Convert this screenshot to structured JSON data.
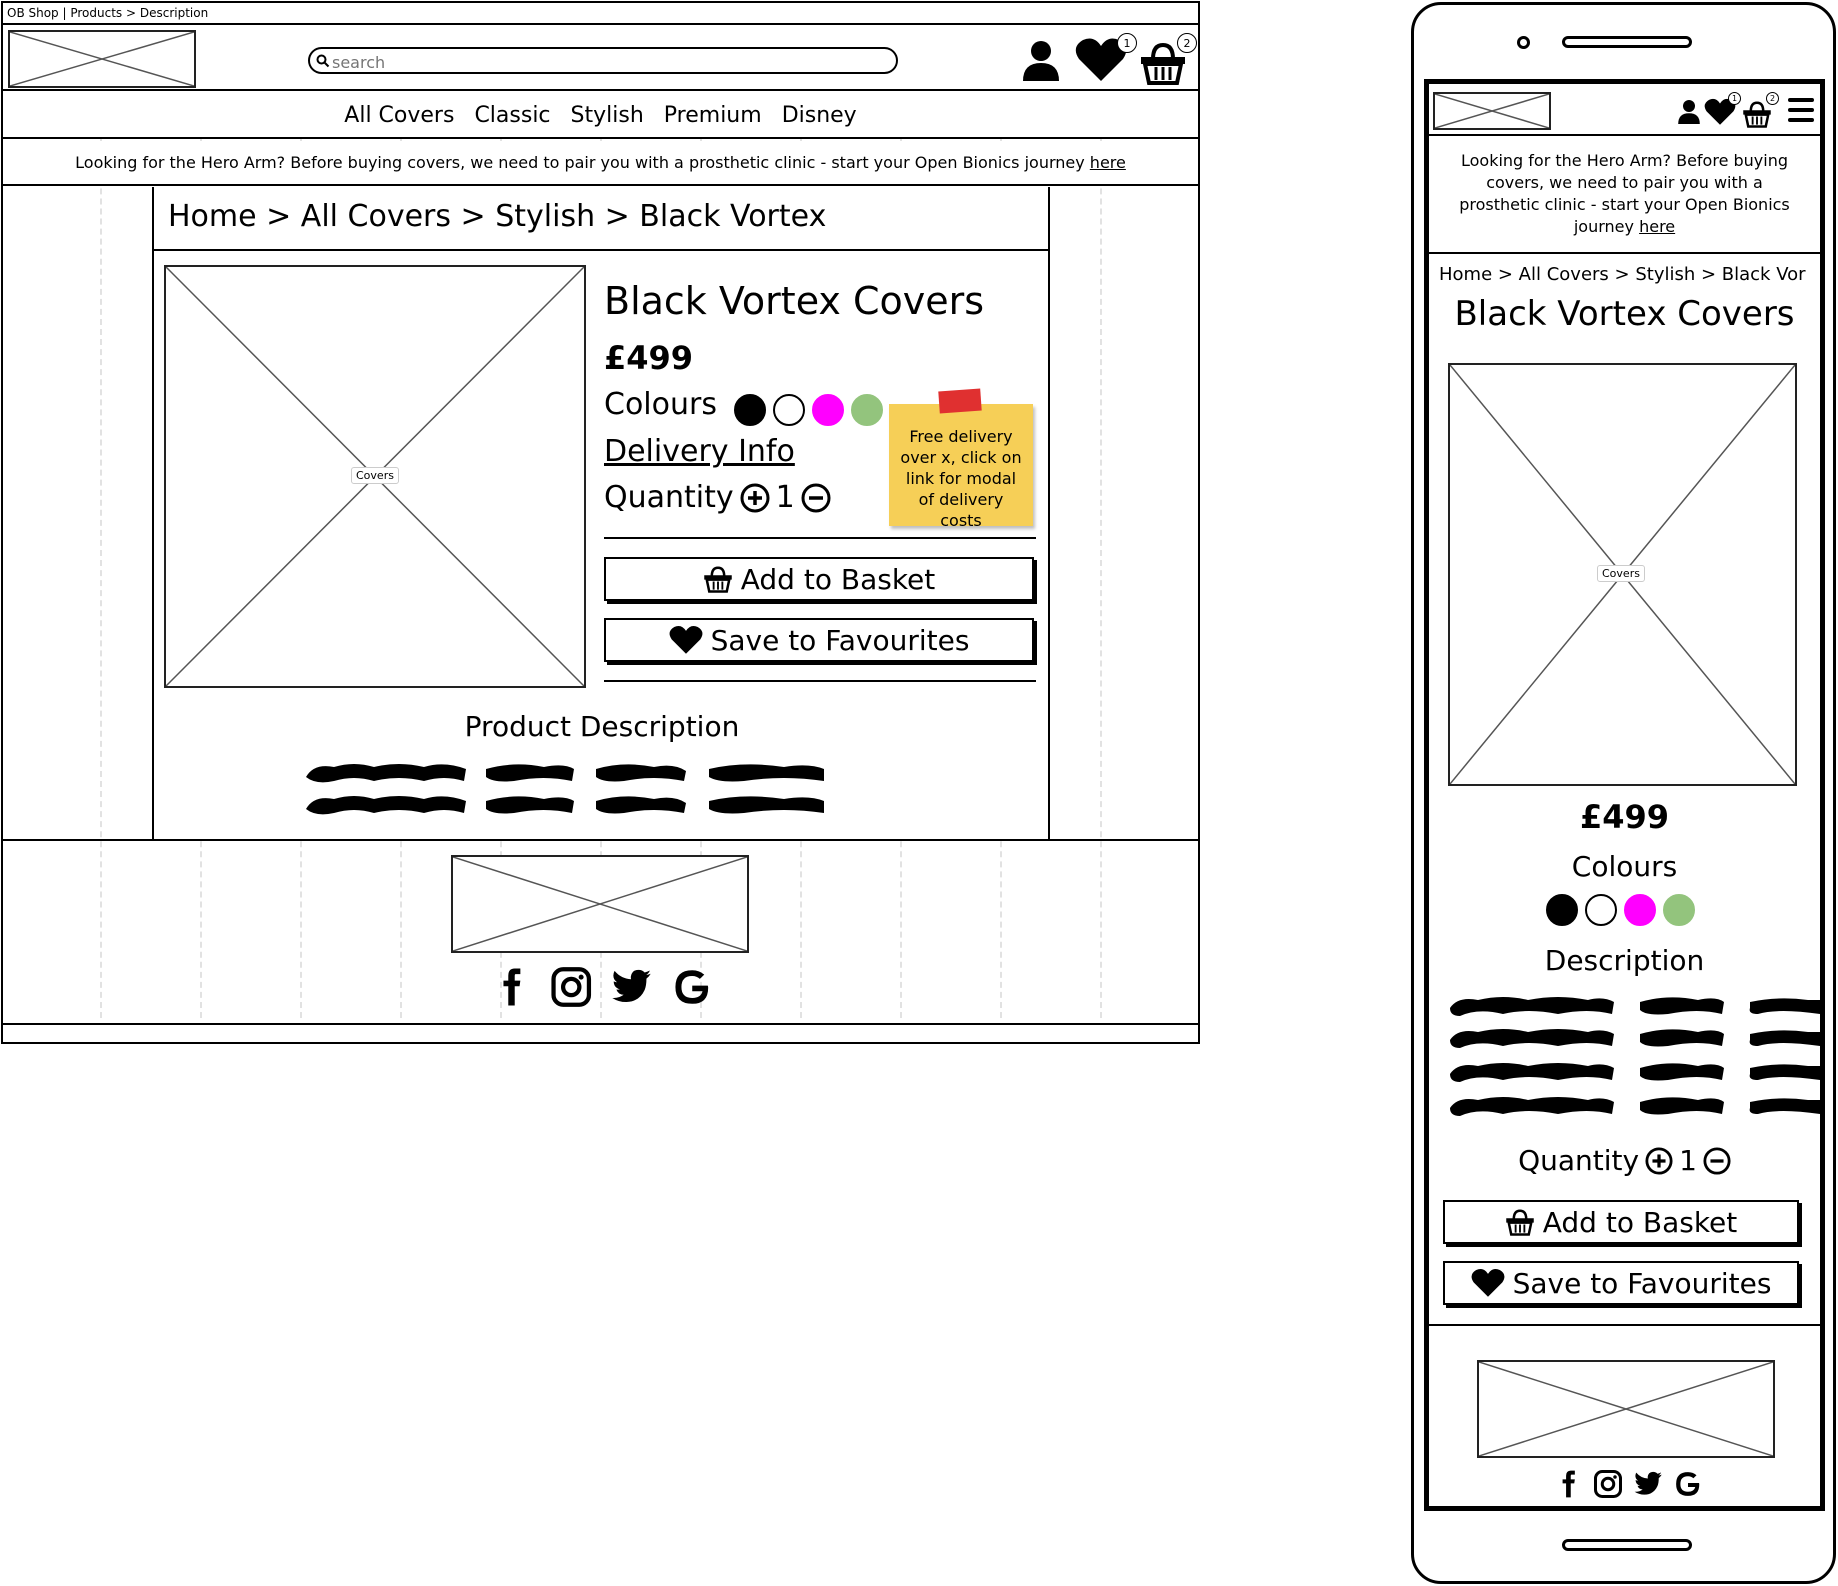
{
  "window": {
    "title": "OB Shop | Products > Description"
  },
  "desktop": {
    "search": {
      "placeholder": "search"
    },
    "header_badges": {
      "favourites": "1",
      "basket": "2"
    },
    "nav": [
      "All Covers",
      "Classic",
      "Stylish",
      "Premium",
      "Disney"
    ],
    "banner": {
      "text": "Looking for the Hero Arm? Before buying covers, we need to pair you with a prosthetic clinic - start your Open Bionics journey",
      "link": "here"
    },
    "breadcrumb": "Home > All Covers > Stylish > Black Vortex",
    "product": {
      "image_label": "Covers",
      "title": "Black Vortex Covers",
      "price": "£499",
      "colours_label": "Colours",
      "delivery_label": "Delivery Info",
      "quantity_label": "Quantity",
      "quantity_value": "1",
      "add_to_basket": "Add to Basket",
      "save_to_favourites": "Save to Favourites",
      "description_heading": "Product Description"
    },
    "sticky_note": "Free delivery over x, click on link for modal of delivery costs"
  },
  "mobile": {
    "header_badges": {
      "favourites": "1",
      "basket": "2"
    },
    "banner": {
      "text": "Looking for the Hero Arm? Before buying covers, we need to pair you with a prosthetic clinic - start your Open Bionics journey",
      "link": "here"
    },
    "breadcrumb": "Home > All Covers > Stylish > Black Vor",
    "product": {
      "title": "Black Vortex Covers",
      "image_label": "Covers",
      "price": "£499",
      "colours_label": "Colours",
      "description_heading": "Description",
      "quantity_label": "Quantity",
      "quantity_value": "1",
      "add_to_basket": "Add to Basket",
      "save_to_favourites": "Save to Favourites"
    }
  },
  "colours": {
    "swatches": [
      "#000000",
      "#ffffff",
      "#ff00ff",
      "#93c47d"
    ],
    "sticky_note": "#f6cf57",
    "tape": "#e03030"
  },
  "icons": [
    "user-icon",
    "heart-icon",
    "basket-icon",
    "menu-icon",
    "facebook-icon",
    "instagram-icon",
    "twitter-icon",
    "google-icon"
  ]
}
